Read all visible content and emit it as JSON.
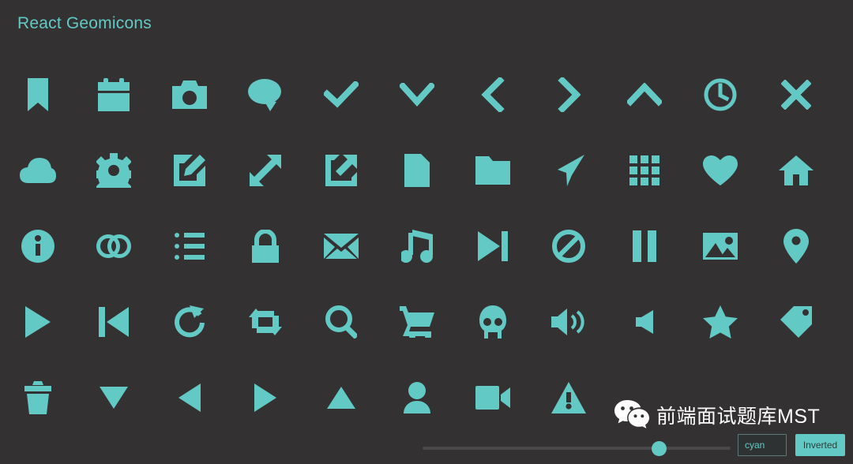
{
  "app": {
    "title": "React Geomicons",
    "background_color": "#333132",
    "accent_color": "#63c9c4"
  },
  "icon_grid": {
    "columns": 11,
    "rows": [
      [
        {
          "name": "bookmark-icon",
          "label": "bookmark"
        },
        {
          "name": "calendar-icon",
          "label": "calendar"
        },
        {
          "name": "camera-icon",
          "label": "camera"
        },
        {
          "name": "chat-icon",
          "label": "chat"
        },
        {
          "name": "check-icon",
          "label": "check"
        },
        {
          "name": "chevron-down-icon",
          "label": "chevron-down"
        },
        {
          "name": "chevron-left-icon",
          "label": "chevron-left"
        },
        {
          "name": "chevron-right-icon",
          "label": "chevron-right"
        },
        {
          "name": "chevron-up-icon",
          "label": "chevron-up"
        },
        {
          "name": "clock-icon",
          "label": "clock"
        },
        {
          "name": "close-icon",
          "label": "close"
        }
      ],
      [
        {
          "name": "cloud-icon",
          "label": "cloud"
        },
        {
          "name": "cog-icon",
          "label": "cog"
        },
        {
          "name": "edit-icon",
          "label": "edit"
        },
        {
          "name": "expand-icon",
          "label": "expand"
        },
        {
          "name": "external-link-icon",
          "label": "external-link"
        },
        {
          "name": "file-icon",
          "label": "file"
        },
        {
          "name": "folder-icon",
          "label": "folder"
        },
        {
          "name": "send-icon",
          "label": "send"
        },
        {
          "name": "grid-icon",
          "label": "grid"
        },
        {
          "name": "heart-icon",
          "label": "heart"
        },
        {
          "name": "home-icon",
          "label": "home"
        }
      ],
      [
        {
          "name": "info-icon",
          "label": "info"
        },
        {
          "name": "link-icon",
          "label": "link"
        },
        {
          "name": "list-icon",
          "label": "list"
        },
        {
          "name": "lock-icon",
          "label": "lock"
        },
        {
          "name": "mail-icon",
          "label": "mail"
        },
        {
          "name": "music-icon",
          "label": "music"
        },
        {
          "name": "next-icon",
          "label": "next"
        },
        {
          "name": "no-icon",
          "label": "no"
        },
        {
          "name": "pause-icon",
          "label": "pause"
        },
        {
          "name": "picture-icon",
          "label": "picture"
        },
        {
          "name": "pin-icon",
          "label": "pin"
        }
      ],
      [
        {
          "name": "play-icon",
          "label": "play"
        },
        {
          "name": "previous-icon",
          "label": "previous"
        },
        {
          "name": "refresh-icon",
          "label": "refresh"
        },
        {
          "name": "retweet-icon",
          "label": "retweet"
        },
        {
          "name": "search-icon",
          "label": "search"
        },
        {
          "name": "shopping-cart-icon",
          "label": "shopping-cart"
        },
        {
          "name": "skull-icon",
          "label": "skull"
        },
        {
          "name": "sound-on-icon",
          "label": "sound-on"
        },
        {
          "name": "sound-off-icon",
          "label": "sound-off"
        },
        {
          "name": "star-icon",
          "label": "star"
        },
        {
          "name": "tag-icon",
          "label": "tag"
        }
      ],
      [
        {
          "name": "trash-icon",
          "label": "trash"
        },
        {
          "name": "triangle-down-icon",
          "label": "triangle-down"
        },
        {
          "name": "triangle-left-icon",
          "label": "triangle-left"
        },
        {
          "name": "triangle-right-icon",
          "label": "triangle-right"
        },
        {
          "name": "triangle-up-icon",
          "label": "triangle-up"
        },
        {
          "name": "user-icon",
          "label": "user"
        },
        {
          "name": "video-icon",
          "label": "video"
        },
        {
          "name": "warning-icon",
          "label": "warning"
        }
      ]
    ]
  },
  "controls": {
    "slider": {
      "name": "size-slider",
      "value_percent": 75
    },
    "color_input": {
      "value": "cyan",
      "placeholder": "color"
    },
    "inverted_button": {
      "label": "Inverted",
      "active": true
    }
  },
  "watermark": {
    "icon": "wechat-icon",
    "text": "前端面试题库MST"
  }
}
